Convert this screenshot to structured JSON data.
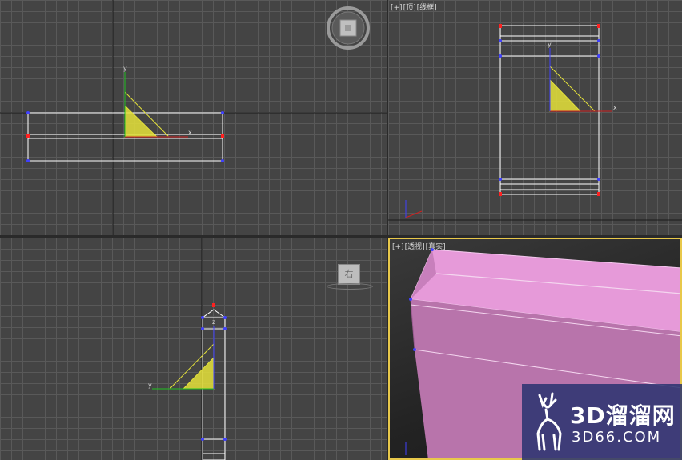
{
  "viewports": {
    "top_left": {
      "label_parts": [],
      "axis_x": "x",
      "axis_y": "y"
    },
    "top_right": {
      "label_parts": [
        "[+]",
        "[顶]",
        "[线框]"
      ],
      "axis_x": "x",
      "axis_y": "y"
    },
    "bottom_left": {
      "label_parts": [],
      "axis_x": "y",
      "axis_z": "z",
      "viewcube_label": "右"
    },
    "bottom_right": {
      "label_parts": [
        "[+]",
        "[透视]",
        "[真实]"
      ]
    }
  },
  "watermark": {
    "brand": "3D溜溜网",
    "url": "3D66.COM"
  },
  "colors": {
    "grid_bg": "#444444",
    "grid_line": "#595959",
    "wire": "#ffffff",
    "gizmo_yellow": "#e5e23a",
    "vertex_blue": "#4040ff",
    "vertex_red": "#ff2020",
    "mesh_pink": "#d890cc",
    "active_border": "#e8c84a"
  }
}
